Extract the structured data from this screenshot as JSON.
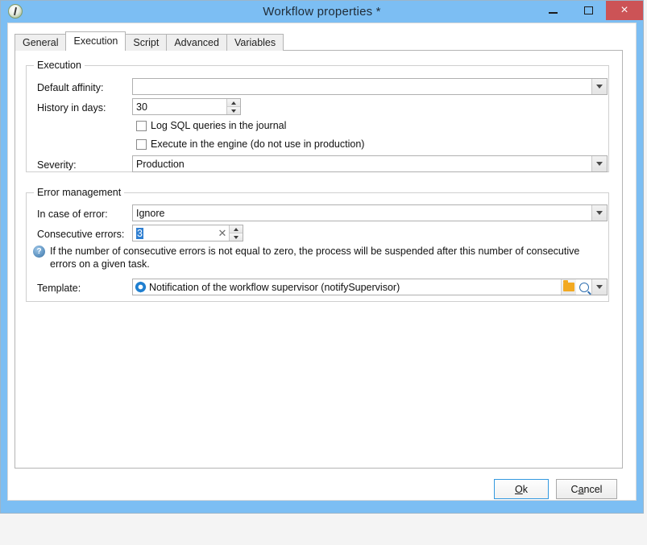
{
  "window": {
    "title": "Workflow properties *",
    "icon": "workflow-app-icon",
    "controls": {
      "minimize": "minimize-icon",
      "maximize": "maximize-icon",
      "close": "×"
    }
  },
  "tabs": [
    {
      "label": "General",
      "active": false
    },
    {
      "label": "Execution",
      "active": true
    },
    {
      "label": "Script",
      "active": false
    },
    {
      "label": "Advanced",
      "active": false
    },
    {
      "label": "Variables",
      "active": false
    }
  ],
  "execution_group": {
    "title": "Execution",
    "default_affinity": {
      "label": "Default affinity:",
      "value": "",
      "placeholder": ""
    },
    "history_in_days": {
      "label": "History in days:",
      "value": "30"
    },
    "log_sql": {
      "label": "Log SQL queries in the journal",
      "checked": false
    },
    "execute_in_engine": {
      "label": "Execute in the engine (do not use in production)",
      "checked": false
    },
    "severity": {
      "label": "Severity:",
      "value": "Production"
    }
  },
  "error_group": {
    "title": "Error management",
    "in_case_of_error": {
      "label": "In case of error:",
      "value": "Ignore"
    },
    "consecutive_errors": {
      "label": "Consecutive errors:",
      "value": "3"
    },
    "help_text": "If the number of consecutive errors is not equal to zero, the process will be suspended after this number of consecutive errors on a given task.",
    "help_icon": "question-help-icon",
    "template": {
      "label": "Template:",
      "value": "Notification of the workflow supervisor (notifySupervisor)",
      "icon": "workflow-template-icon",
      "browse_icon": "folder-icon",
      "search_icon": "magnifier-icon",
      "dropdown_icon": "chevron-down-icon"
    }
  },
  "footer": {
    "ok": {
      "prefix": "O",
      "accel": "O",
      "rest": "k",
      "full": "Ok"
    },
    "cancel": {
      "full": "Cancel",
      "before": "C",
      "accel": "a",
      "after": "ncel"
    }
  },
  "colors": {
    "title_bar": "#7cbef3",
    "close_button": "#cc5356",
    "accent_selection": "#2f7fd1",
    "default_button_border": "#3399e0",
    "folder_icon": "#f2a922",
    "template_icon": "#1f7fd0"
  }
}
